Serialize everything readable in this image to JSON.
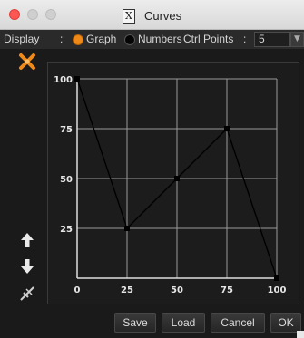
{
  "window": {
    "title": "Curves",
    "title_icon": "X"
  },
  "toolbar": {
    "display_label": "Display",
    "sep1": ":",
    "graph_label": "Graph",
    "numbers_label": "Numbers",
    "ctrl_points_label": "Ctrl Points",
    "sep2": ":",
    "ctrl_points_value": "5",
    "mode_selected": "Graph"
  },
  "tools": [
    "wand-icon",
    "arrow-up-icon",
    "arrow-down-icon",
    "reset-icon"
  ],
  "buttons": {
    "save": "Save",
    "load": "Load",
    "cancel": "Cancel",
    "ok": "OK"
  },
  "colors": {
    "accent": "#ef8a1a",
    "curve": "#000000",
    "grid": "#9a9a9a"
  },
  "chart_data": {
    "type": "line",
    "x": [
      0,
      25,
      50,
      75,
      100
    ],
    "y": [
      100,
      25,
      50,
      75,
      0
    ],
    "xlim": [
      0,
      100
    ],
    "ylim": [
      0,
      100
    ],
    "x_ticks": [
      "0",
      "25",
      "50",
      "75",
      "100"
    ],
    "y_ticks": [
      "100",
      "75",
      "50",
      "25"
    ],
    "grid": true
  }
}
